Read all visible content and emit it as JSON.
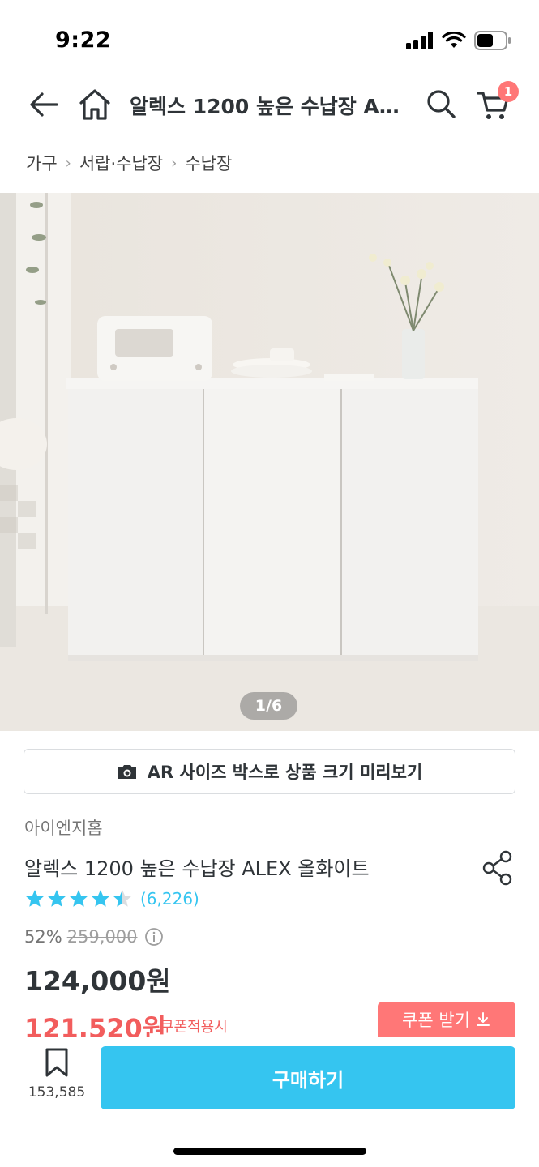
{
  "status_bar": {
    "time": "9:22"
  },
  "nav": {
    "title": "알렉스 1200 높은 수납장 AL...",
    "cart_badge": "1"
  },
  "breadcrumb": {
    "items": [
      "가구",
      "서랍·수납장",
      "수납장"
    ]
  },
  "hero": {
    "counter": "1/6"
  },
  "ar_button": {
    "label": "AR 사이즈 박스로 상품 크기 미리보기"
  },
  "product": {
    "brand": "아이엔지홈",
    "name": "알렉스 1200 높은 수납장 ALEX 올화이트",
    "rating_value": 4.5,
    "rating_max": 5,
    "review_count": "(6,226)",
    "discount_rate": "52%",
    "original_price": "259,000",
    "sale_price": "124,000원",
    "coupon_price": "121,520원",
    "coupon_note": "쿠폰적용시",
    "coupon_button": "쿠폰 받기"
  },
  "bottom_bar": {
    "bookmark_count": "153,585",
    "buy_label": "구매하기"
  },
  "colors": {
    "accent": "#35c5f0",
    "coupon": "#f25d5d",
    "badge": "#ff7777"
  }
}
